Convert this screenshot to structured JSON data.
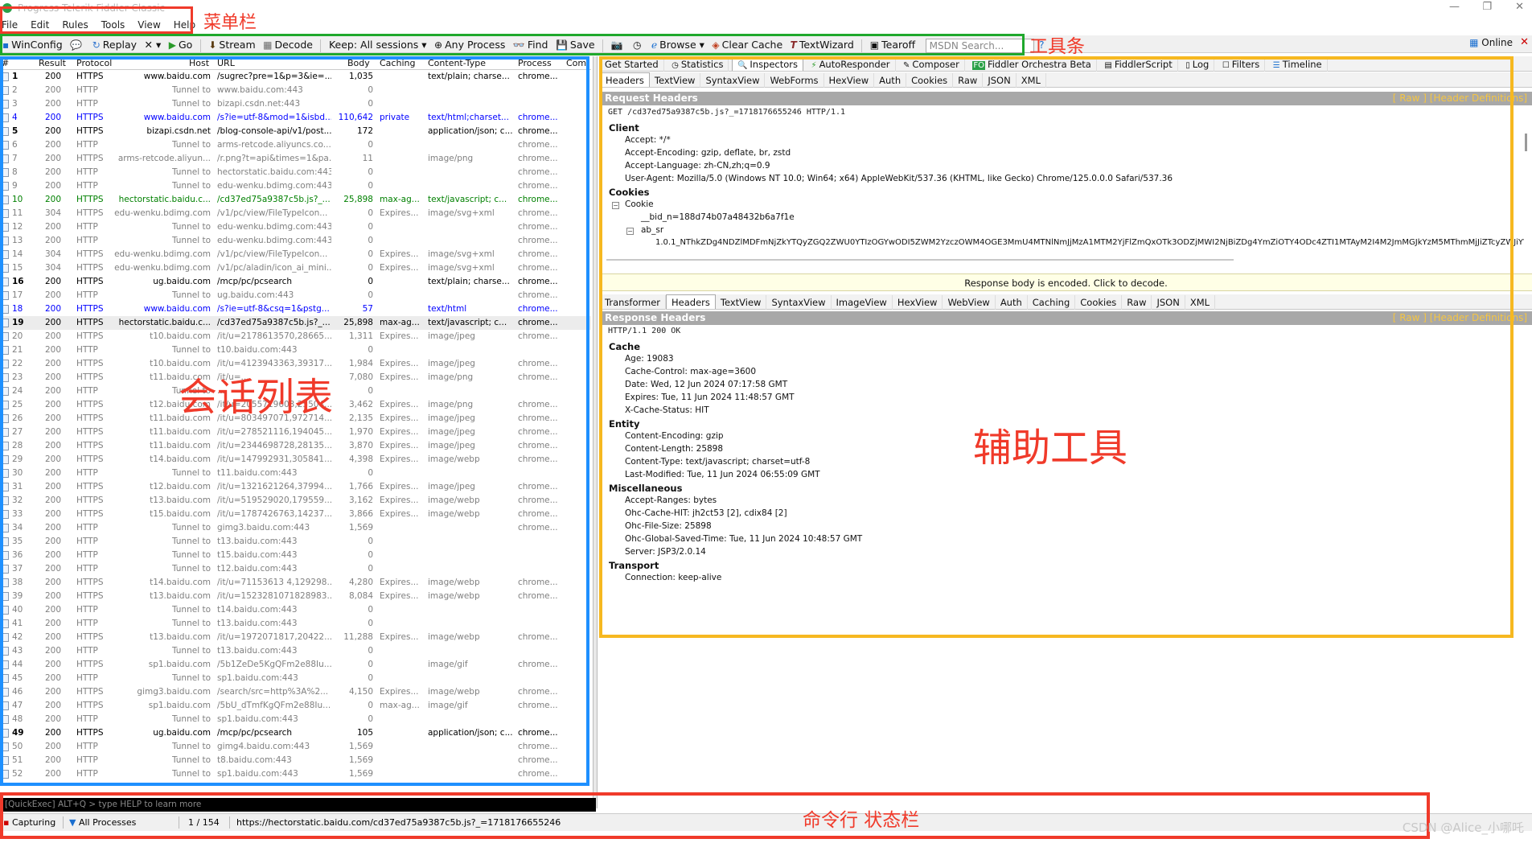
{
  "window": {
    "title": "Progress Telerik Fiddler Classic"
  },
  "menu": [
    "File",
    "Edit",
    "Rules",
    "Tools",
    "View",
    "Help"
  ],
  "toolbar": {
    "items": [
      "WinConfig",
      "Replay",
      "✕ ▾",
      "Go",
      "Stream",
      "Decode",
      "Keep: All sessions ▾",
      "Any Process",
      "Find",
      "Save",
      "Browse ▾",
      "Clear Cache",
      "TextWizard",
      "Tearoff"
    ],
    "msdn_placeholder": "MSDN Search...",
    "online": "Online"
  },
  "sessions": {
    "columns": [
      "#",
      "Result",
      "Protocol",
      "Host",
      "URL",
      "Body",
      "Caching",
      "Content-Type",
      "Process",
      "Com"
    ],
    "rows": [
      {
        "id": "1",
        "result": "200",
        "protocol": "HTTPS",
        "host": "www.baidu.com",
        "url": "/sugrec?pre=1&p=3&ie=...",
        "body": "1,035",
        "caching": "",
        "ctype": "text/plain; charse...",
        "process": "chrome...",
        "color": "#000"
      },
      {
        "id": "2",
        "result": "200",
        "protocol": "HTTP",
        "host": "Tunnel to",
        "url": "www.baidu.com:443",
        "body": "0",
        "caching": "",
        "ctype": "",
        "process": "",
        "color": "#808080"
      },
      {
        "id": "3",
        "result": "200",
        "protocol": "HTTP",
        "host": "Tunnel to",
        "url": "bizapi.csdn.net:443",
        "body": "0",
        "caching": "",
        "ctype": "",
        "process": "",
        "color": "#808080"
      },
      {
        "id": "4",
        "result": "200",
        "protocol": "HTTPS",
        "host": "www.baidu.com",
        "url": "/s?ie=utf-8&mod=1&isbd...",
        "body": "110,642",
        "caching": "private",
        "ctype": "text/html;charset...",
        "process": "chrome...",
        "color": "#0000ff"
      },
      {
        "id": "5",
        "result": "200",
        "protocol": "HTTPS",
        "host": "bizapi.csdn.net",
        "url": "/blog-console-api/v1/post...",
        "body": "172",
        "caching": "",
        "ctype": "application/json; c...",
        "process": "chrome...",
        "color": "#000"
      },
      {
        "id": "6",
        "result": "200",
        "protocol": "HTTP",
        "host": "Tunnel to",
        "url": "arms-retcode.aliyuncs.co...",
        "body": "0",
        "caching": "",
        "ctype": "",
        "process": "chrome...",
        "color": "#808080"
      },
      {
        "id": "7",
        "result": "200",
        "protocol": "HTTPS",
        "host": "arms-retcode.aliyun...",
        "url": "/r.png?t=api&times=1&pa...",
        "body": "11",
        "caching": "",
        "ctype": "image/png",
        "process": "chrome...",
        "color": "#808080"
      },
      {
        "id": "8",
        "result": "200",
        "protocol": "HTTP",
        "host": "Tunnel to",
        "url": "hectorstatic.baidu.com:443",
        "body": "0",
        "caching": "",
        "ctype": "",
        "process": "chrome...",
        "color": "#808080"
      },
      {
        "id": "9",
        "result": "200",
        "protocol": "HTTP",
        "host": "Tunnel to",
        "url": "edu-wenku.bdimg.com:443",
        "body": "0",
        "caching": "",
        "ctype": "",
        "process": "chrome...",
        "color": "#808080"
      },
      {
        "id": "10",
        "result": "200",
        "protocol": "HTTPS",
        "host": "hectorstatic.baidu.c...",
        "url": "/cd37ed75a9387c5b.js?_...",
        "body": "25,898",
        "caching": "max-ag...",
        "ctype": "text/javascript; c...",
        "process": "chrome...",
        "color": "#008000"
      },
      {
        "id": "11",
        "result": "304",
        "protocol": "HTTPS",
        "host": "edu-wenku.bdimg.com",
        "url": "/v1/pc/view/FileTypeIcon...",
        "body": "0",
        "caching": "Expires...",
        "ctype": "image/svg+xml",
        "process": "chrome...",
        "color": "#808080"
      },
      {
        "id": "12",
        "result": "200",
        "protocol": "HTTP",
        "host": "Tunnel to",
        "url": "edu-wenku.bdimg.com:443",
        "body": "0",
        "caching": "",
        "ctype": "",
        "process": "chrome...",
        "color": "#808080"
      },
      {
        "id": "13",
        "result": "200",
        "protocol": "HTTP",
        "host": "Tunnel to",
        "url": "edu-wenku.bdimg.com:443",
        "body": "0",
        "caching": "",
        "ctype": "",
        "process": "chrome...",
        "color": "#808080"
      },
      {
        "id": "14",
        "result": "304",
        "protocol": "HTTPS",
        "host": "edu-wenku.bdimg.com",
        "url": "/v1/pc/view/FileTypeIcon...",
        "body": "0",
        "caching": "Expires...",
        "ctype": "image/svg+xml",
        "process": "chrome...",
        "color": "#808080"
      },
      {
        "id": "15",
        "result": "304",
        "protocol": "HTTPS",
        "host": "edu-wenku.bdimg.com",
        "url": "/v1/pc/aladin/icon_ai_mini...",
        "body": "0",
        "caching": "Expires...",
        "ctype": "image/svg+xml",
        "process": "chrome...",
        "color": "#808080"
      },
      {
        "id": "16",
        "result": "200",
        "protocol": "HTTPS",
        "host": "ug.baidu.com",
        "url": "/mcp/pc/pcsearch",
        "body": "0",
        "caching": "",
        "ctype": "text/plain; charse...",
        "process": "chrome...",
        "color": "#000"
      },
      {
        "id": "17",
        "result": "200",
        "protocol": "HTTP",
        "host": "Tunnel to",
        "url": "ug.baidu.com:443",
        "body": "0",
        "caching": "",
        "ctype": "",
        "process": "chrome...",
        "color": "#808080"
      },
      {
        "id": "18",
        "result": "200",
        "protocol": "HTTPS",
        "host": "www.baidu.com",
        "url": "/s?ie=utf-8&csq=1&pstg...",
        "body": "57",
        "caching": "",
        "ctype": "text/html",
        "process": "chrome...",
        "color": "#0000ff"
      },
      {
        "id": "19",
        "result": "200",
        "protocol": "HTTPS",
        "host": "hectorstatic.baidu.c...",
        "url": "/cd37ed75a9387c5b.js?_...",
        "body": "25,898",
        "caching": "max-ag...",
        "ctype": "text/javascript; c...",
        "process": "chrome...",
        "color": "#000",
        "selected": true
      },
      {
        "id": "20",
        "result": "200",
        "protocol": "HTTPS",
        "host": "t10.baidu.com",
        "url": "/it/u=2178613570,28665...",
        "body": "1,311",
        "caching": "Expires...",
        "ctype": "image/jpeg",
        "process": "chrome...",
        "color": "#808080"
      },
      {
        "id": "21",
        "result": "200",
        "protocol": "HTTP",
        "host": "Tunnel to",
        "url": "t10.baidu.com:443",
        "body": "0",
        "caching": "",
        "ctype": "",
        "process": "",
        "color": "#808080"
      },
      {
        "id": "22",
        "result": "200",
        "protocol": "HTTPS",
        "host": "t10.baidu.com",
        "url": "/it/u=4123943363,39317...",
        "body": "1,984",
        "caching": "Expires...",
        "ctype": "image/jpeg",
        "process": "chrome...",
        "color": "#808080"
      },
      {
        "id": "23",
        "result": "200",
        "protocol": "HTTPS",
        "host": "t11.baidu.com",
        "url": "/it/u=...",
        "body": "7,080",
        "caching": "Expires...",
        "ctype": "image/png",
        "process": "chrome...",
        "color": "#808080"
      },
      {
        "id": "24",
        "result": "200",
        "protocol": "HTTP",
        "host": "Tunnel to",
        "url": "...",
        "body": "0",
        "caching": "",
        "ctype": "",
        "process": "",
        "color": "#808080"
      },
      {
        "id": "25",
        "result": "200",
        "protocol": "HTTPS",
        "host": "t12.baidu.com",
        "url": "/it/u=2055719603,25504...",
        "body": "3,462",
        "caching": "Expires...",
        "ctype": "image/png",
        "process": "chrome...",
        "color": "#808080"
      },
      {
        "id": "26",
        "result": "200",
        "protocol": "HTTPS",
        "host": "t11.baidu.com",
        "url": "/it/u=803497071,972714...",
        "body": "2,135",
        "caching": "Expires...",
        "ctype": "image/jpeg",
        "process": "chrome...",
        "color": "#808080"
      },
      {
        "id": "27",
        "result": "200",
        "protocol": "HTTPS",
        "host": "t11.baidu.com",
        "url": "/it/u=278521116,194045...",
        "body": "1,970",
        "caching": "Expires...",
        "ctype": "image/jpeg",
        "process": "chrome...",
        "color": "#808080"
      },
      {
        "id": "28",
        "result": "200",
        "protocol": "HTTPS",
        "host": "t11.baidu.com",
        "url": "/it/u=2344698728,28135...",
        "body": "3,870",
        "caching": "Expires...",
        "ctype": "image/jpeg",
        "process": "chrome...",
        "color": "#808080"
      },
      {
        "id": "29",
        "result": "200",
        "protocol": "HTTPS",
        "host": "t14.baidu.com",
        "url": "/it/u=147992931,305841...",
        "body": "4,398",
        "caching": "Expires...",
        "ctype": "image/webp",
        "process": "chrome...",
        "color": "#808080"
      },
      {
        "id": "30",
        "result": "200",
        "protocol": "HTTP",
        "host": "Tunnel to",
        "url": "t11.baidu.com:443",
        "body": "0",
        "caching": "",
        "ctype": "",
        "process": "",
        "color": "#808080"
      },
      {
        "id": "31",
        "result": "200",
        "protocol": "HTTPS",
        "host": "t12.baidu.com",
        "url": "/it/u=1321621264,37994...",
        "body": "1,766",
        "caching": "Expires...",
        "ctype": "image/jpeg",
        "process": "chrome...",
        "color": "#808080"
      },
      {
        "id": "32",
        "result": "200",
        "protocol": "HTTPS",
        "host": "t13.baidu.com",
        "url": "/it/u=519529020,179559...",
        "body": "3,162",
        "caching": "Expires...",
        "ctype": "image/webp",
        "process": "chrome...",
        "color": "#808080"
      },
      {
        "id": "33",
        "result": "200",
        "protocol": "HTTPS",
        "host": "t15.baidu.com",
        "url": "/it/u=1787426763,14237...",
        "body": "3,866",
        "caching": "Expires...",
        "ctype": "image/webp",
        "process": "chrome...",
        "color": "#808080"
      },
      {
        "id": "34",
        "result": "200",
        "protocol": "HTTP",
        "host": "Tunnel to",
        "url": "gimg3.baidu.com:443",
        "body": "1,569",
        "caching": "",
        "ctype": "",
        "process": "chrome...",
        "color": "#808080"
      },
      {
        "id": "35",
        "result": "200",
        "protocol": "HTTP",
        "host": "Tunnel to",
        "url": "t13.baidu.com:443",
        "body": "0",
        "caching": "",
        "ctype": "",
        "process": "",
        "color": "#808080"
      },
      {
        "id": "36",
        "result": "200",
        "protocol": "HTTP",
        "host": "Tunnel to",
        "url": "t15.baidu.com:443",
        "body": "0",
        "caching": "",
        "ctype": "",
        "process": "",
        "color": "#808080"
      },
      {
        "id": "37",
        "result": "200",
        "protocol": "HTTP",
        "host": "Tunnel to",
        "url": "t12.baidu.com:443",
        "body": "0",
        "caching": "",
        "ctype": "",
        "process": "",
        "color": "#808080"
      },
      {
        "id": "38",
        "result": "200",
        "protocol": "HTTPS",
        "host": "t14.baidu.com",
        "url": "/it/u=71153613 4,129298...",
        "body": "4,280",
        "caching": "Expires...",
        "ctype": "image/webp",
        "process": "chrome...",
        "color": "#808080"
      },
      {
        "id": "39",
        "result": "200",
        "protocol": "HTTPS",
        "host": "t13.baidu.com",
        "url": "/it/u=1523281071828983...",
        "body": "8,084",
        "caching": "Expires...",
        "ctype": "image/webp",
        "process": "chrome...",
        "color": "#808080"
      },
      {
        "id": "40",
        "result": "200",
        "protocol": "HTTP",
        "host": "Tunnel to",
        "url": "t14.baidu.com:443",
        "body": "0",
        "caching": "",
        "ctype": "",
        "process": "",
        "color": "#808080"
      },
      {
        "id": "41",
        "result": "200",
        "protocol": "HTTP",
        "host": "Tunnel to",
        "url": "t13.baidu.com:443",
        "body": "0",
        "caching": "",
        "ctype": "",
        "process": "",
        "color": "#808080"
      },
      {
        "id": "42",
        "result": "200",
        "protocol": "HTTPS",
        "host": "t13.baidu.com",
        "url": "/it/u=1972071817,20422...",
        "body": "11,288",
        "caching": "Expires...",
        "ctype": "image/webp",
        "process": "chrome...",
        "color": "#808080"
      },
      {
        "id": "43",
        "result": "200",
        "protocol": "HTTP",
        "host": "Tunnel to",
        "url": "t13.baidu.com:443",
        "body": "0",
        "caching": "",
        "ctype": "",
        "process": "",
        "color": "#808080"
      },
      {
        "id": "44",
        "result": "200",
        "protocol": "HTTPS",
        "host": "sp1.baidu.com",
        "url": "/5b1ZeDe5KgQFm2e88Iu...",
        "body": "0",
        "caching": "",
        "ctype": "image/gif",
        "process": "chrome...",
        "color": "#808080"
      },
      {
        "id": "45",
        "result": "200",
        "protocol": "HTTP",
        "host": "Tunnel to",
        "url": "sp1.baidu.com:443",
        "body": "0",
        "caching": "",
        "ctype": "",
        "process": "",
        "color": "#808080"
      },
      {
        "id": "46",
        "result": "200",
        "protocol": "HTTPS",
        "host": "gimg3.baidu.com",
        "url": "/search/src=http%3A%2...",
        "body": "4,150",
        "caching": "Expires...",
        "ctype": "image/webp",
        "process": "chrome...",
        "color": "#808080"
      },
      {
        "id": "47",
        "result": "200",
        "protocol": "HTTPS",
        "host": "sp1.baidu.com",
        "url": "/5bU_dTmfKgQFm2e88Iu...",
        "body": "0",
        "caching": "max-ag...",
        "ctype": "image/gif",
        "process": "chrome...",
        "color": "#808080"
      },
      {
        "id": "48",
        "result": "200",
        "protocol": "HTTP",
        "host": "Tunnel to",
        "url": "sp1.baidu.com:443",
        "body": "0",
        "caching": "",
        "ctype": "",
        "process": "",
        "color": "#808080"
      },
      {
        "id": "49",
        "result": "200",
        "protocol": "HTTPS",
        "host": "ug.baidu.com",
        "url": "/mcp/pc/pcsearch",
        "body": "105",
        "caching": "",
        "ctype": "application/json; c...",
        "process": "chrome...",
        "color": "#000"
      },
      {
        "id": "50",
        "result": "200",
        "protocol": "HTTP",
        "host": "Tunnel to",
        "url": "gimg4.baidu.com:443",
        "body": "1,569",
        "caching": "",
        "ctype": "",
        "process": "chrome...",
        "color": "#808080"
      },
      {
        "id": "51",
        "result": "200",
        "protocol": "HTTP",
        "host": "Tunnel to",
        "url": "t8.baidu.com:443",
        "body": "1,569",
        "caching": "",
        "ctype": "",
        "process": "chrome...",
        "color": "#808080"
      },
      {
        "id": "52",
        "result": "200",
        "protocol": "HTTP",
        "host": "Tunnel to",
        "url": "sp1.baidu.com:443",
        "body": "1,569",
        "caching": "",
        "ctype": "",
        "process": "chrome...",
        "color": "#808080"
      }
    ]
  },
  "top_tabs": [
    "Get Started",
    "Statistics",
    "Inspectors",
    "AutoResponder",
    "Composer",
    "Fiddler Orchestra Beta",
    "FiddlerScript",
    "Log",
    "Filters",
    "Timeline"
  ],
  "request": {
    "subtabs": [
      "Headers",
      "TextView",
      "SyntaxView",
      "WebForms",
      "HexView",
      "Auth",
      "Cookies",
      "Raw",
      "JSON",
      "XML"
    ],
    "section_title": "Request Headers",
    "links": "[ Raw ]   [Header Definitions]",
    "request_line": "GET /cd37ed75a9387c5b.js?_=1718176655246 HTTP/1.1",
    "client_group": "Client",
    "client": [
      "Accept: */*",
      "Accept-Encoding: gzip, deflate, br, zstd",
      "Accept-Language: zh-CN,zh;q=0.9",
      "User-Agent: Mozilla/5.0 (Windows NT 10.0; Win64; x64) AppleWebKit/537.36 (KHTML, like Gecko) Chrome/125.0.0.0 Safari/537.36"
    ],
    "cookies_group": "Cookies",
    "cookie_node": "Cookie",
    "bid": "__bid_n=188d74b07a48432b6a7f1e",
    "ab_sr": "ab_sr",
    "ab_sr_value": "1.0.1_NThkZDg4NDZlMDFmNjZkYTQyZGQ2ZWU0YTIzOGYwODI5ZWM2YzczOWM4OGE3MmU4MTNlNmJjMzA1MTM2YjFlZmQxOTk3ODZjMWI2NjBiZDg4YmZiOTY4ODc4ZTI1MTAyM2I4M2JmMGJkYzM5MThmMjJiZTcyZWJiYWQ0M"
  },
  "notice": "Response body is encoded. Click to decode.",
  "response": {
    "subtabs": [
      "Transformer",
      "Headers",
      "TextView",
      "SyntaxView",
      "ImageView",
      "HexView",
      "WebView",
      "Auth",
      "Caching",
      "Cookies",
      "Raw",
      "JSON",
      "XML"
    ],
    "section_title": "Response Headers",
    "links": "[ Raw ]   [Header Definitions]",
    "status_line": "HTTP/1.1 200 OK",
    "groups": [
      {
        "name": "Cache",
        "items": [
          "Age: 19083",
          "Cache-Control: max-age=3600",
          "Date: Wed, 12 Jun 2024 07:17:58 GMT",
          "Expires: Tue, 11 Jun 2024 11:48:57 GMT",
          "X-Cache-Status: HIT"
        ]
      },
      {
        "name": "Entity",
        "items": [
          "Content-Encoding: gzip",
          "Content-Length: 25898",
          "Content-Type: text/javascript; charset=utf-8",
          "Last-Modified: Tue, 11 Jun 2024 06:55:09 GMT"
        ]
      },
      {
        "name": "Miscellaneous",
        "items": [
          "Accept-Ranges: bytes",
          "Ohc-Cache-HIT: jh2ct53 [2], cdix84 [2]",
          "Ohc-File-Size: 25898",
          "Ohc-Global-Saved-Time: Tue, 11 Jun 2024 10:48:57 GMT",
          "Server: JSP3/2.0.14"
        ]
      },
      {
        "name": "Transport",
        "items": [
          "Connection: keep-alive"
        ]
      }
    ]
  },
  "quickexec": "[QuickExec] ALT+Q > type HELP to learn more",
  "status": {
    "capturing": "Capturing",
    "processes": "All Processes",
    "count": "1 / 154",
    "url": "https://hectorstatic.baidu.com/cd37ed75a9387c5b.js?_=1718176655246"
  },
  "annotations": {
    "menu": "菜单栏",
    "toolbar": "工具条",
    "sessions": "会话列表",
    "tools": "辅助工具",
    "cmd": "命令行 状态栏"
  },
  "watermark": "CSDN @Alice_小哪吒",
  "colors": {
    "red": "#f03a2a",
    "green": "#1fa82c",
    "blue": "#1e90ff",
    "orange": "#f6b820"
  }
}
